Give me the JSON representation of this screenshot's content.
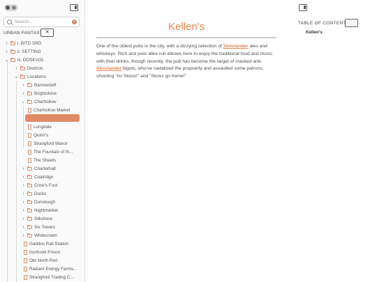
{
  "sidebar": {
    "search_placeholder": "Search...",
    "vault_name": "URBAN FANTASY",
    "collapse_glyph": "✕",
    "items": [
      {
        "label": "i. BITD SRD",
        "type": "folder",
        "chev": "›"
      },
      {
        "label": "ii. SETTING",
        "type": "folder",
        "chev": "›"
      },
      {
        "label": "iii. DOSKVOL",
        "type": "folder",
        "chev": "⌄"
      },
      {
        "label": "Districts",
        "type": "folder",
        "chev": "›"
      },
      {
        "label": "Locations",
        "type": "folder",
        "chev": "⌄"
      },
      {
        "label": "Barrowcleft",
        "type": "folder",
        "chev": "›"
      },
      {
        "label": "Brightstone",
        "type": "folder",
        "chev": "›"
      },
      {
        "label": "Charhollow",
        "type": "folder",
        "chev": "⌄"
      },
      {
        "label": "Charhollow Market",
        "type": "file",
        "chev": ""
      },
      {
        "label": "",
        "type": "active",
        "chev": ""
      },
      {
        "label": "Longdale",
        "type": "file",
        "chev": ""
      },
      {
        "label": "Quinn's",
        "type": "file",
        "chev": ""
      },
      {
        "label": "Strangford Manor",
        "type": "file",
        "chev": ""
      },
      {
        "label": "The Fountain of th...",
        "type": "file",
        "chev": ""
      },
      {
        "label": "The Sheets",
        "type": "file",
        "chev": ""
      },
      {
        "label": "Charterhall",
        "type": "folder",
        "chev": "›"
      },
      {
        "label": "Coalridge",
        "type": "folder",
        "chev": "›"
      },
      {
        "label": "Crow's Foot",
        "type": "folder",
        "chev": "›"
      },
      {
        "label": "Docks",
        "type": "folder",
        "chev": "›"
      },
      {
        "label": "Dunslough",
        "type": "folder",
        "chev": "›"
      },
      {
        "label": "Nightmarket",
        "type": "folder",
        "chev": "›"
      },
      {
        "label": "Silkshore",
        "type": "folder",
        "chev": "›"
      },
      {
        "label": "Six Towers",
        "type": "folder",
        "chev": "›"
      },
      {
        "label": "Whitecrown",
        "type": "folder",
        "chev": "›"
      },
      {
        "label": "Gaddoc Rail Station",
        "type": "file",
        "chev": ""
      },
      {
        "label": "Ironhook Prison",
        "type": "file",
        "chev": ""
      },
      {
        "label": "Old North Port",
        "type": "file",
        "chev": ""
      },
      {
        "label": "Radiant Energy Farms...",
        "type": "file",
        "chev": ""
      },
      {
        "label": "Strangford Trading C...",
        "type": "file",
        "chev": ""
      }
    ]
  },
  "note": {
    "title": "Kellen's",
    "p1": "One of the oldest pubs in the city, with a dizzying selection of ",
    "link1": "Skovlander",
    "p2": " ales and whiskeys. Rich and poor alike rub elbows here to enjoy the traditional food and music with their drinks, though recently, the pub has become the target of masked anti-",
    "link2": "Skovlander",
    "p3": " bigots, who've nadalized the propoerty and assaulted some patrons, shouting \"no Skovs!\" and \"Skovs go home!\""
  },
  "toc": {
    "label": "TABLE OF CONTENTS",
    "items": [
      "Kellen's"
    ]
  },
  "colors": {
    "accent": "#e0864f",
    "active_bg": "#e08b64"
  },
  "icons": {
    "search": "search-icon",
    "panel": "sidebar-toggle-icon",
    "folder": "folder-icon",
    "file": "file-icon"
  }
}
